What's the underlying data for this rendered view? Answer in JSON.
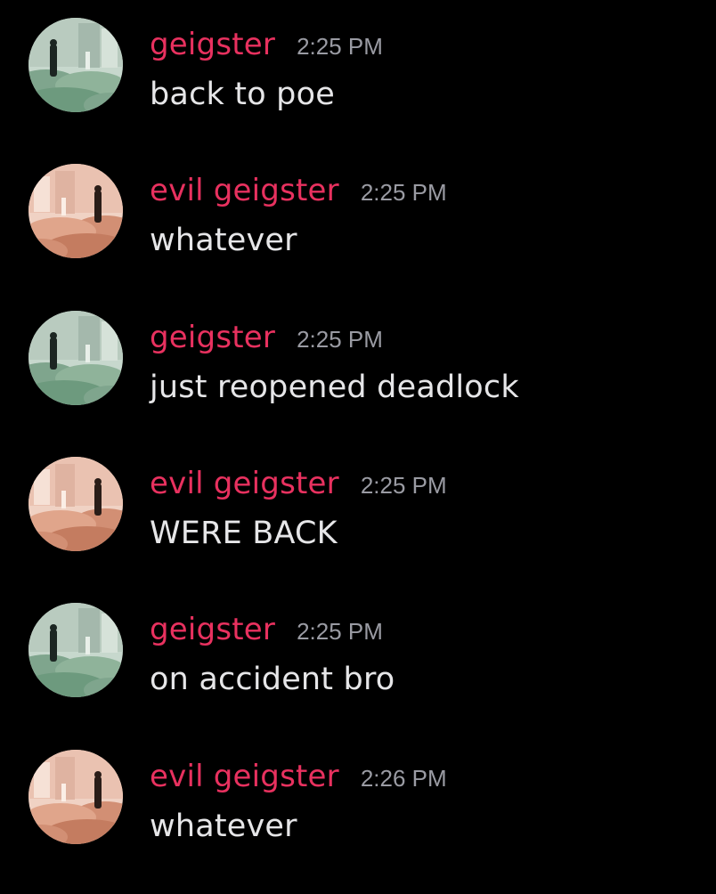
{
  "messages": [
    {
      "username": "geigster",
      "timestamp": "2:25 PM",
      "text": "back to poe",
      "avatar": "geigster-avatar"
    },
    {
      "username": "evil geigster",
      "timestamp": "2:25 PM",
      "text": "whatever",
      "avatar": "evil-geigster-avatar"
    },
    {
      "username": "geigster",
      "timestamp": "2:25 PM",
      "text": "just reopened deadlock",
      "avatar": "geigster-avatar"
    },
    {
      "username": "evil geigster",
      "timestamp": "2:25 PM",
      "text": "WERE BACK",
      "avatar": "evil-geigster-avatar"
    },
    {
      "username": "geigster",
      "timestamp": "2:25 PM",
      "text": "on accident bro",
      "avatar": "geigster-avatar"
    },
    {
      "username": "evil geigster",
      "timestamp": "2:26 PM",
      "text": "whatever",
      "avatar": "evil-geigster-avatar"
    }
  ],
  "colors": {
    "background": "#000000",
    "username": "#e8315f",
    "timestamp": "#9a9ba3",
    "text": "#e6e6e8",
    "avatar_green": "#9fc0a6",
    "avatar_pink": "#e9b19a"
  }
}
